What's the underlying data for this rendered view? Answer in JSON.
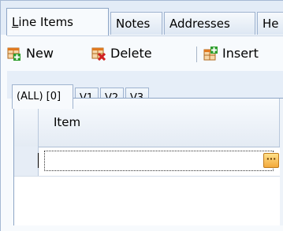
{
  "tabs": [
    {
      "pre": "",
      "u": "L",
      "post": "ine Items",
      "active": true
    },
    {
      "pre": "Notes",
      "u": "",
      "post": "",
      "active": false
    },
    {
      "pre": "Addresses",
      "u": "",
      "post": "",
      "active": false
    },
    {
      "pre": "He",
      "u": "",
      "post": "",
      "active": false
    }
  ],
  "toolbar": {
    "new_label": "New",
    "delete_label": "Delete",
    "insert_label": "Insert"
  },
  "views": [
    {
      "label": "(ALL) [0]",
      "active": true
    },
    {
      "label": "V1",
      "active": false
    },
    {
      "label": "V2",
      "active": false
    },
    {
      "label": "V3",
      "active": false
    }
  ],
  "grid": {
    "column_header": "Item",
    "ellipsis": "···",
    "cell_value": ""
  },
  "colors": {
    "accent_orange": "#f08a24",
    "border_blue": "#8ea6c6",
    "tab_bg": "#e3ecf7"
  },
  "icons": {
    "new": "new-grid-icon",
    "delete": "delete-grid-icon",
    "insert": "insert-grid-icon"
  }
}
